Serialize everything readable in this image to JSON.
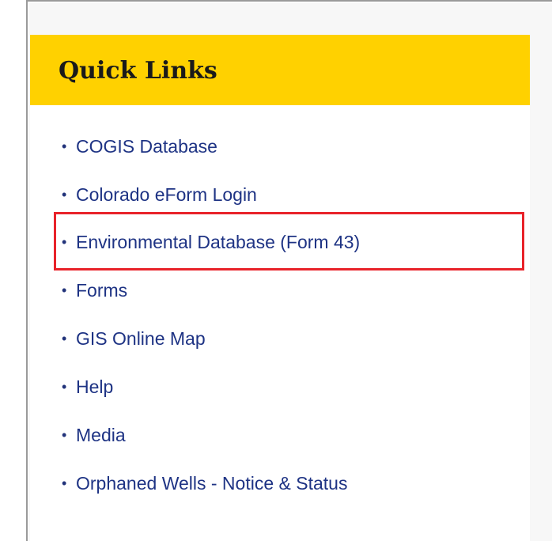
{
  "panel": {
    "title": "Quick Links",
    "header_color": "#ffd100",
    "link_color": "#1e3384",
    "highlight_color": "#e8232a",
    "bullet": "•",
    "items": [
      {
        "label": "COGIS Database"
      },
      {
        "label": "Colorado eForm Login"
      },
      {
        "label": "Environmental Database (Form 43)",
        "highlighted": true
      },
      {
        "label": "Forms"
      },
      {
        "label": "GIS Online Map"
      },
      {
        "label": "Help"
      },
      {
        "label": "Media"
      },
      {
        "label": "Orphaned Wells - Notice & Status"
      }
    ]
  }
}
